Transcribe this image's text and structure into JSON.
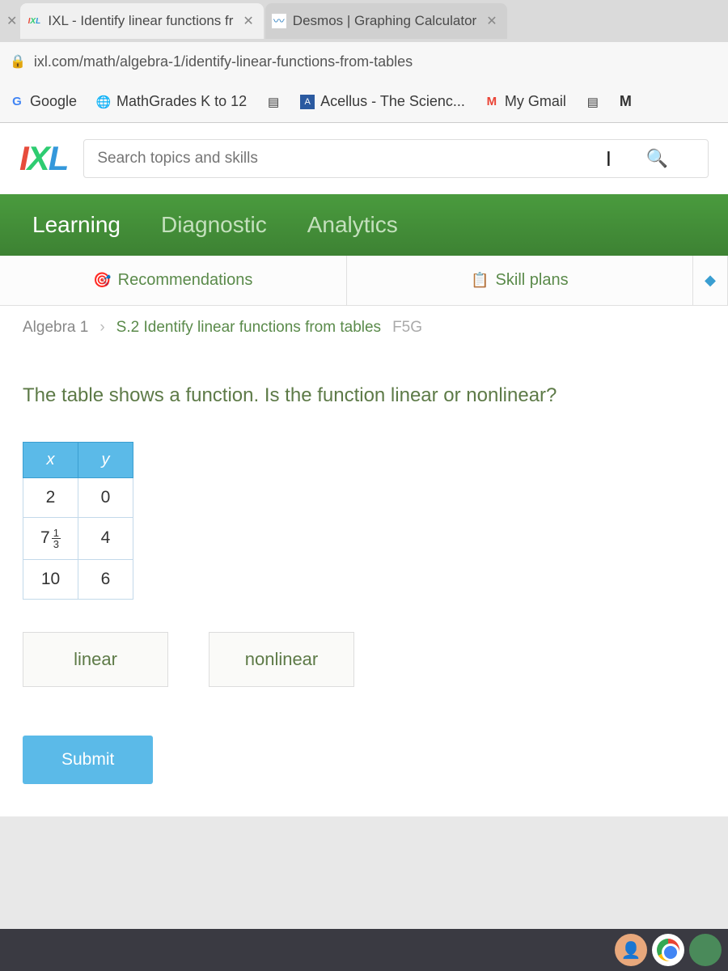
{
  "tabs": [
    {
      "title": "IXL - Identify linear functions fr"
    },
    {
      "title": "Desmos | Graphing Calculator"
    }
  ],
  "url": "ixl.com/math/algebra-1/identify-linear-functions-from-tables",
  "bookmarks": [
    {
      "label": "Google"
    },
    {
      "label": "MathGrades K to 12"
    },
    {
      "label": "Acellus - The Scienc..."
    },
    {
      "label": "My Gmail"
    }
  ],
  "search_placeholder": "Search topics and skills",
  "nav": {
    "learning": "Learning",
    "diagnostic": "Diagnostic",
    "analytics": "Analytics"
  },
  "subnav": {
    "recommendations": "Recommendations",
    "skillplans": "Skill plans"
  },
  "breadcrumb": {
    "course": "Algebra 1",
    "skill": "S.2 Identify linear functions from tables",
    "code": "F5G"
  },
  "question": "The table shows a function. Is the function linear or nonlinear?",
  "chart_data": {
    "type": "table",
    "columns": [
      "x",
      "y"
    ],
    "rows": [
      {
        "x": "2",
        "y": "0"
      },
      {
        "x_whole": "7",
        "x_num": "1",
        "x_den": "3",
        "y": "4"
      },
      {
        "x": "10",
        "y": "6"
      }
    ]
  },
  "answers": {
    "linear": "linear",
    "nonlinear": "nonlinear"
  },
  "submit_label": "Submit"
}
